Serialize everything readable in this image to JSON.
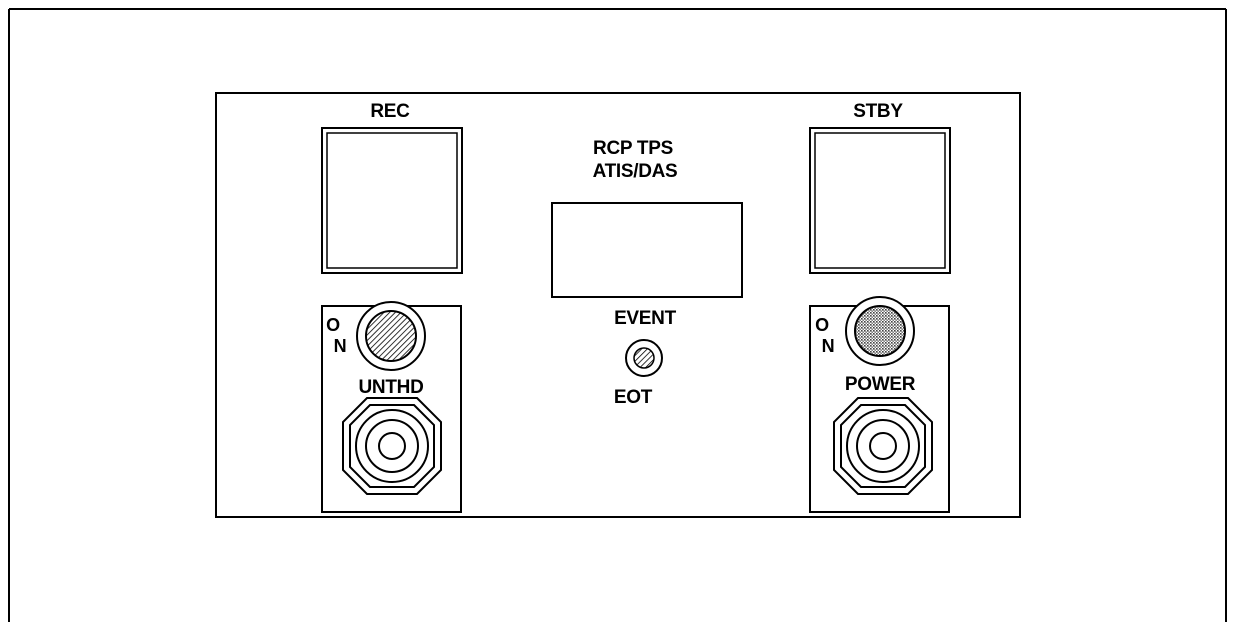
{
  "panel": {
    "rec_label": "REC",
    "stby_label": "STBY",
    "display_title_line1": "RCP TPS",
    "display_title_line2": "ATIS/DAS",
    "event_label": "EVENT",
    "eot_label": "EOT",
    "left_on_label_o": "O",
    "left_on_label_n": "N",
    "right_on_label_o": "O",
    "right_on_label_n": "N",
    "unthd_label": "UNTHD",
    "power_label": "POWER"
  }
}
